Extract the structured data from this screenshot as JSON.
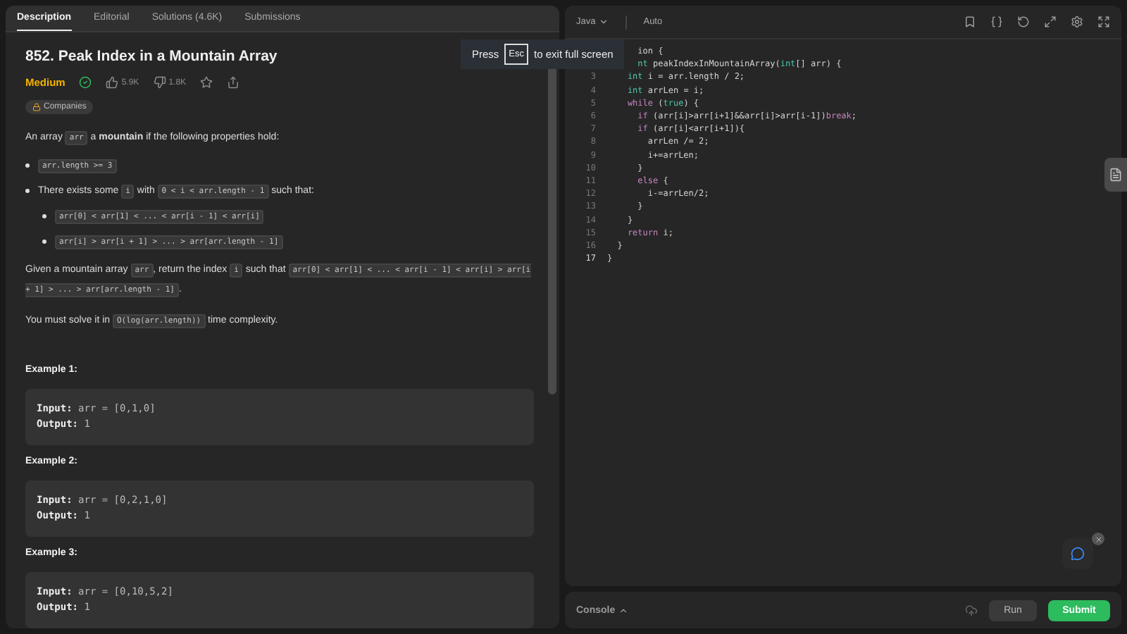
{
  "tabs": [
    {
      "label": "Description",
      "selected": true
    },
    {
      "label": "Editorial",
      "selected": false
    },
    {
      "label": "Solutions (4.6K)",
      "selected": false
    },
    {
      "label": "Submissions",
      "selected": false
    }
  ],
  "problem": {
    "title": "852. Peak Index in a Mountain Array",
    "difficulty": "Medium",
    "solved": true,
    "likes": "5.9K",
    "dislikes": "1.8K",
    "companies": "Companies"
  },
  "description": [
    {
      "kind": "para",
      "parts": [
        {
          "kind": "text",
          "text": "An array "
        },
        {
          "kind": "code",
          "text": "arr"
        },
        {
          "kind": "text",
          "text": " a "
        },
        {
          "kind": "bold",
          "text": "mountain"
        },
        {
          "kind": "text",
          "text": " if the following properties hold:"
        }
      ]
    },
    {
      "kind": "bullet",
      "parts": [
        {
          "kind": "code",
          "text": "arr.length >= 3"
        }
      ]
    },
    {
      "kind": "bullet",
      "parts": [
        {
          "kind": "text",
          "text": "There exists some "
        },
        {
          "kind": "code",
          "text": "i"
        },
        {
          "kind": "text",
          "text": " with "
        },
        {
          "kind": "code",
          "text": "0 < i < arr.length - 1"
        },
        {
          "kind": "text",
          "text": " such that:"
        }
      ]
    },
    {
      "kind": "subbullet",
      "parts": [
        {
          "kind": "code",
          "text": "arr[0] < arr[1] < ... < arr[i - 1] < arr[i]"
        }
      ]
    },
    {
      "kind": "subbullet",
      "parts": [
        {
          "kind": "code",
          "text": "arr[i] > arr[i + 1] > ... > arr[arr.length - 1]"
        }
      ]
    },
    {
      "kind": "para",
      "parts": [
        {
          "kind": "text",
          "text": "Given a mountain array "
        },
        {
          "kind": "code",
          "text": "arr"
        },
        {
          "kind": "text",
          "text": ", return the index "
        },
        {
          "kind": "code",
          "text": "i"
        },
        {
          "kind": "text",
          "text": " such that "
        },
        {
          "kind": "code",
          "text": "arr[0] < arr[1] < ... < arr[i - 1] < arr[i] > arr[i + 1] > ... > arr[arr.length - 1]"
        },
        {
          "kind": "text",
          "text": "."
        }
      ]
    },
    {
      "kind": "para",
      "parts": [
        {
          "kind": "text",
          "text": "You must solve it in "
        },
        {
          "kind": "code",
          "text": "O(log(arr.length))"
        },
        {
          "kind": "text",
          "text": " time complexity."
        }
      ]
    }
  ],
  "examples": [
    {
      "title": "Example 1:",
      "input_label": "Input:",
      "input": "arr = [0,1,0]",
      "output_label": "Output:",
      "output": "1"
    },
    {
      "title": "Example 2:",
      "input_label": "Input:",
      "input": "arr = [0,2,1,0]",
      "output_label": "Output:",
      "output": "1"
    },
    {
      "title": "Example 3:",
      "input_label": "Input:",
      "input": "arr = [0,10,5,2]",
      "output_label": "Output:",
      "output": "1"
    }
  ],
  "editor": {
    "language": "Java",
    "mode": "Auto",
    "lines": [
      {
        "segs": [
          {
            "kind": "plain",
            "text": "      ion {"
          }
        ]
      },
      {
        "segs": [
          {
            "kind": "type",
            "text": "      nt"
          },
          {
            "kind": "plain",
            "text": " peakIndexInMountainArray("
          },
          {
            "kind": "type",
            "text": "int"
          },
          {
            "kind": "plain",
            "text": "[] arr) {"
          }
        ]
      },
      {
        "number": "3",
        "segs": [
          {
            "kind": "type",
            "text": "    int"
          },
          {
            "kind": "plain",
            "text": " i = arr.length / 2;"
          }
        ]
      },
      {
        "number": "4",
        "segs": [
          {
            "kind": "type",
            "text": "    int"
          },
          {
            "kind": "plain",
            "text": " arrLen = i;"
          }
        ]
      },
      {
        "number": "5",
        "segs": [
          {
            "kind": "keyword",
            "text": "    while"
          },
          {
            "kind": "plain",
            "text": " ("
          },
          {
            "kind": "type",
            "text": "true"
          },
          {
            "kind": "plain",
            "text": ") {"
          }
        ]
      },
      {
        "number": "6",
        "segs": [
          {
            "kind": "keyword",
            "text": "      if"
          },
          {
            "kind": "plain",
            "text": " (arr[i]>arr[i+1]&&arr[i]>arr[i-1])"
          },
          {
            "kind": "keyword",
            "text": "break"
          },
          {
            "kind": "plain",
            "text": ";"
          }
        ]
      },
      {
        "number": "7",
        "segs": [
          {
            "kind": "keyword",
            "text": "      if"
          },
          {
            "kind": "plain",
            "text": " (arr[i]<arr[i+1]){"
          }
        ]
      },
      {
        "number": "8",
        "segs": [
          {
            "kind": "plain",
            "text": "        arrLen /= 2;"
          }
        ]
      },
      {
        "number": "9",
        "segs": [
          {
            "kind": "plain",
            "text": "        i+=arrLen;"
          }
        ]
      },
      {
        "number": "10",
        "segs": [
          {
            "kind": "plain",
            "text": "      }"
          }
        ]
      },
      {
        "number": "11",
        "segs": [
          {
            "kind": "keyword",
            "text": "      else"
          },
          {
            "kind": "plain",
            "text": " {"
          }
        ]
      },
      {
        "number": "12",
        "segs": [
          {
            "kind": "plain",
            "text": "        i-=arrLen/2;"
          }
        ]
      },
      {
        "number": "13",
        "segs": [
          {
            "kind": "plain",
            "text": "      }"
          }
        ]
      },
      {
        "number": "14",
        "segs": [
          {
            "kind": "plain",
            "text": "    }"
          }
        ]
      },
      {
        "number": "15",
        "segs": [
          {
            "kind": "keyword",
            "text": "    return"
          },
          {
            "kind": "plain",
            "text": " i;"
          }
        ]
      },
      {
        "number": "16",
        "segs": [
          {
            "kind": "plain",
            "text": "  }"
          }
        ]
      },
      {
        "number": "17",
        "segs": [
          {
            "kind": "plain",
            "text": "}"
          }
        ]
      }
    ]
  },
  "fullscreen_notice": {
    "before": "Press",
    "key": "Esc",
    "after": "to exit full screen"
  },
  "console": {
    "label": "Console",
    "run": "Run",
    "submit": "Submit"
  }
}
